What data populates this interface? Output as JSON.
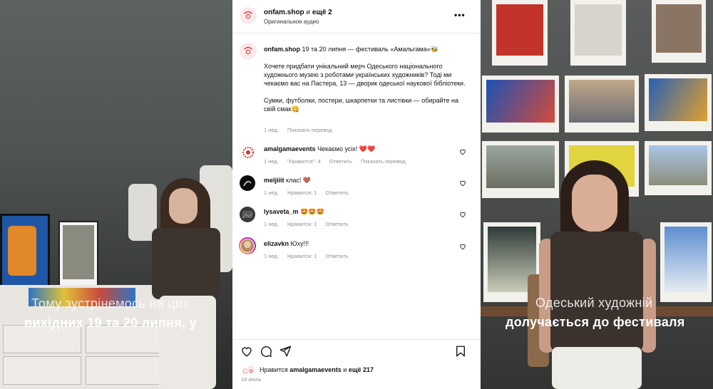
{
  "post": {
    "header": {
      "username": "onfam.shop",
      "joiner": "и",
      "others": "ещё 2",
      "audio": "Оригинальное аудио"
    },
    "caption": {
      "username": "onfam.shop",
      "first_line": "19 та 20 липня — фестиваль «Амальгама»🐝",
      "paragraph1": "Хочете придбати унікальний мерч Одеського національного художнього музею з роботами українських художників? Тоді ми чекаємо вас на Пастера, 13 — дворик одеської наукової бібліотеки.",
      "paragraph2": "Сумки, футболки, постери, шкарпетки та листівки — обирайте на свій смак😋",
      "time": "1 нед.",
      "translate": "Показать перевод"
    },
    "comments": [
      {
        "user": "amalgamaevents",
        "text": "Чекаємо усіх! ❤️❤️",
        "time": "1 нед.",
        "likes": "\"Нравится\": 4",
        "reply": "Ответить",
        "translate": "Показать перевод"
      },
      {
        "user": "meljiiit",
        "text": "клас! 🤎",
        "time": "1 нед.",
        "likes": "Нравится: 1",
        "reply": "Ответить"
      },
      {
        "user": "lysaveta_m",
        "text": "🤩🤩🤩",
        "time": "1 нед.",
        "likes": "Нравится: 1",
        "reply": "Ответить"
      },
      {
        "user": "elizavkn",
        "text": "Юху!!!",
        "time": "1 нед.",
        "likes": "Нравится: 1",
        "reply": "Ответить"
      }
    ],
    "footer": {
      "likes_prefix": "Нравится",
      "likes_user": "amalgamaevents",
      "likes_joiner": "и",
      "likes_rest": "ещё 217",
      "date": "18 июль"
    },
    "icons": [
      "heart-icon",
      "comment-icon",
      "share-icon",
      "bookmark-icon",
      "more-icon"
    ]
  },
  "left_video": {
    "caption_line1": "Тому зустрінемось на цих",
    "caption_line2": "вихідних 19 та 20 липня, у"
  },
  "right_video": {
    "caption_line1": "Одеський художній",
    "caption_line2": "долучається до фестиваля"
  },
  "colors": {
    "muted": "#8e8e8e",
    "text": "#111111",
    "brand_red": "#d63a45"
  }
}
